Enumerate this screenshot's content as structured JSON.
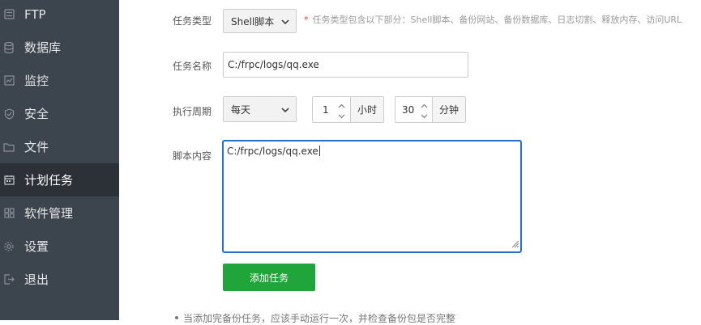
{
  "sidebar": {
    "items": [
      {
        "label": "FTP",
        "icon": "ftp-icon"
      },
      {
        "label": "数据库",
        "icon": "database-icon"
      },
      {
        "label": "监控",
        "icon": "monitor-icon"
      },
      {
        "label": "安全",
        "icon": "shield-icon"
      },
      {
        "label": "文件",
        "icon": "folder-icon"
      },
      {
        "label": "计划任务",
        "icon": "calendar-icon",
        "active": true
      },
      {
        "label": "软件管理",
        "icon": "apps-icon"
      },
      {
        "label": "设置",
        "icon": "gear-icon"
      },
      {
        "label": "退出",
        "icon": "logout-icon"
      }
    ]
  },
  "form": {
    "task_type": {
      "label": "任务类型",
      "value": "Shell脚本",
      "hint_star": "*",
      "hint": "任务类型包含以下部分：Shell脚本、备份网站、备份数据库、日志切割、释放内存、访问URL"
    },
    "task_name": {
      "label": "任务名称",
      "value": "C:/frpc/logs/qq.exe"
    },
    "period": {
      "label": "执行周期",
      "frequency": "每天",
      "hour_value": "1",
      "hour_unit": "小时",
      "minute_value": "30",
      "minute_unit": "分钟"
    },
    "script": {
      "label": "脚本内容",
      "value": "C:/frpc/logs/qq.exe"
    },
    "submit_label": "添加任务"
  },
  "tip": "当添加完备份任务，应该手动运行一次，并检查备份包是否完整",
  "colors": {
    "sidebar_bg": "#3c444d",
    "sidebar_active_bg": "#2c3138",
    "primary_green": "#20a53a",
    "focus_blue": "#2370d4",
    "hint_star_red": "#e4393c"
  }
}
